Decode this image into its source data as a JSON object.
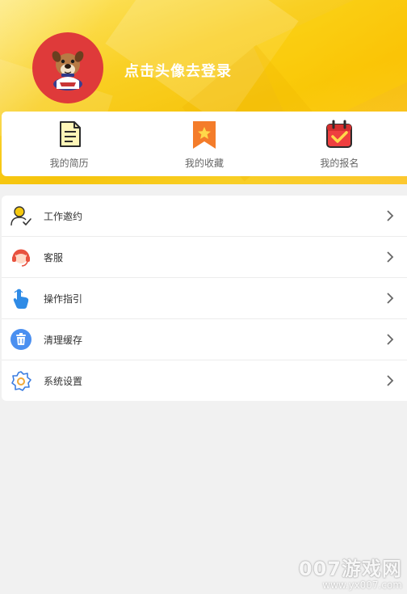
{
  "header": {
    "login_prompt": "点击头像去登录",
    "avatar_icon": "bulldog-mascot-icon",
    "avatar_color": "#df3a3a",
    "accent_color": "#f9cf22"
  },
  "quick_links": [
    {
      "label": "我的简历",
      "icon": "resume-document-icon"
    },
    {
      "label": "我的收藏",
      "icon": "bookmark-star-icon"
    },
    {
      "label": "我的报名",
      "icon": "calendar-check-icon"
    }
  ],
  "menu": [
    {
      "label": "工作邀约",
      "icon": "person-check-icon"
    },
    {
      "label": "客服",
      "icon": "customer-service-headset-icon"
    },
    {
      "label": "操作指引",
      "icon": "hand-pointer-icon"
    },
    {
      "label": "清理缓存",
      "icon": "trash-bin-icon"
    },
    {
      "label": "系统设置",
      "icon": "gear-icon"
    }
  ],
  "watermark": {
    "brand": "007游戏网",
    "url": "www.yx007.com"
  }
}
